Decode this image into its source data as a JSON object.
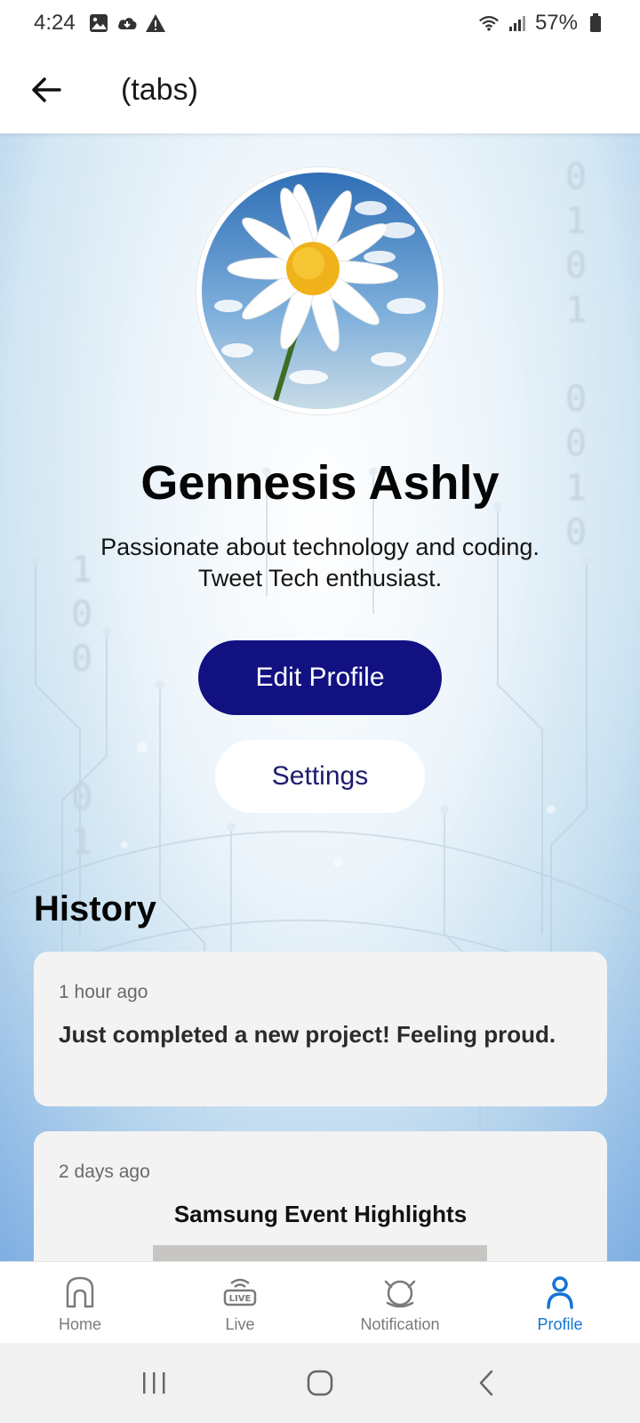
{
  "status_bar": {
    "time": "4:24",
    "battery": "57%",
    "icons": [
      "image-icon",
      "cloud-sync-icon",
      "warning-icon",
      "wifi-icon",
      "signal-icon",
      "battery-icon"
    ]
  },
  "app_bar": {
    "title": "(tabs)",
    "back_icon": "arrow-left-icon"
  },
  "profile": {
    "name": "Gennesis Ashly",
    "bio": "Passionate about technology and coding. Tweet Tech enthusiast.",
    "edit_label": "Edit Profile",
    "settings_label": "Settings",
    "accent_color": "#111182"
  },
  "history": {
    "title": "History",
    "items": [
      {
        "time": "1 hour ago",
        "text": "Just completed a new project! Feeling proud."
      },
      {
        "time": "2 days ago",
        "heading": "Samsung Event Highlights"
      }
    ]
  },
  "bottom_nav": {
    "items": [
      {
        "label": "Home",
        "icon": "home-icon"
      },
      {
        "label": "Live",
        "icon": "live-icon"
      },
      {
        "label": "Notification",
        "icon": "notification-icon"
      },
      {
        "label": "Profile",
        "icon": "profile-icon",
        "active": true
      }
    ],
    "active_color": "#1474d2"
  },
  "system_nav": [
    "recents-button",
    "home-button",
    "back-button"
  ]
}
